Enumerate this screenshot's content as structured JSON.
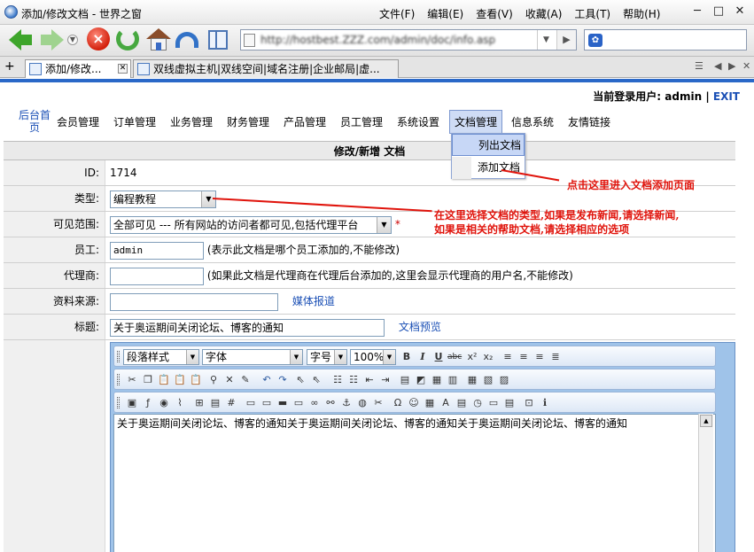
{
  "window": {
    "title": "添加/修改文档 - 世界之窗",
    "menu": [
      "文件(F)",
      "编辑(E)",
      "查看(V)",
      "收藏(A)",
      "工具(T)",
      "帮助(H)"
    ],
    "minimize": "─",
    "maximize": "□",
    "close": "✕"
  },
  "toolbar": {
    "address": "http://hostbest.ZZZ.com/admin/doc/info.asp"
  },
  "tabs": [
    {
      "label": "添加/修改..."
    },
    {
      "label": "双线虚拟主机|双线空间|域名注册|企业邮局|虚..."
    }
  ],
  "header": {
    "login_label": "当前登录用户:",
    "user": "admin",
    "separator": "|",
    "exit": "EXIT"
  },
  "nav": {
    "home": "后台首页",
    "items": [
      "会员管理",
      "订单管理",
      "业务管理",
      "财务管理",
      "产品管理",
      "员工管理",
      "系统设置",
      "文档管理",
      "信息系统",
      "友情链接"
    ]
  },
  "submenu": {
    "items": [
      "列出文档",
      "添加文档"
    ]
  },
  "form": {
    "title": "修改/新增 文档",
    "id_label": "ID:",
    "id_value": "1714",
    "type_label": "类型:",
    "type_value": "编程教程",
    "visibility_label": "可见范围:",
    "visibility_value": "全部可见 --- 所有网站的访问者都可见,包括代理平台",
    "visibility_required": "*",
    "staff_label": "员工:",
    "staff_value": "admin",
    "staff_note": "(表示此文档是哪个员工添加的,不能修改)",
    "agent_label": "代理商:",
    "agent_value": "",
    "agent_note": "(如果此文档是代理商在代理后台添加的,这里会显示代理商的用户名,不能修改)",
    "source_label": "资料来源:",
    "source_value": "",
    "source_link": "媒体报道",
    "subject_label": "标题:",
    "subject_value": "关于奥运期间关闭论坛、博客的通知",
    "preview_link": "文档预览"
  },
  "editor": {
    "format_select": "段落样式",
    "font_select": "字体",
    "size_select": "字号",
    "zoom_select": "100%",
    "content": "关于奥运期间关闭论坛、博客的通知关于奥运期间关闭论坛、博客的通知关于奥运期间关闭论坛、博客的通知"
  },
  "annotations": {
    "add_doc": "点击这里进入文档添加页面",
    "type_line1": "在这里选择文档的类型,如果是发布新闻,请选择新闻,",
    "type_line2": "如果是相关的帮助文档,请选择相应的选项"
  },
  "colors": {
    "annotation": "#e0140c",
    "link": "#1a4fb5",
    "editor_frame": "#9fc3e9"
  }
}
